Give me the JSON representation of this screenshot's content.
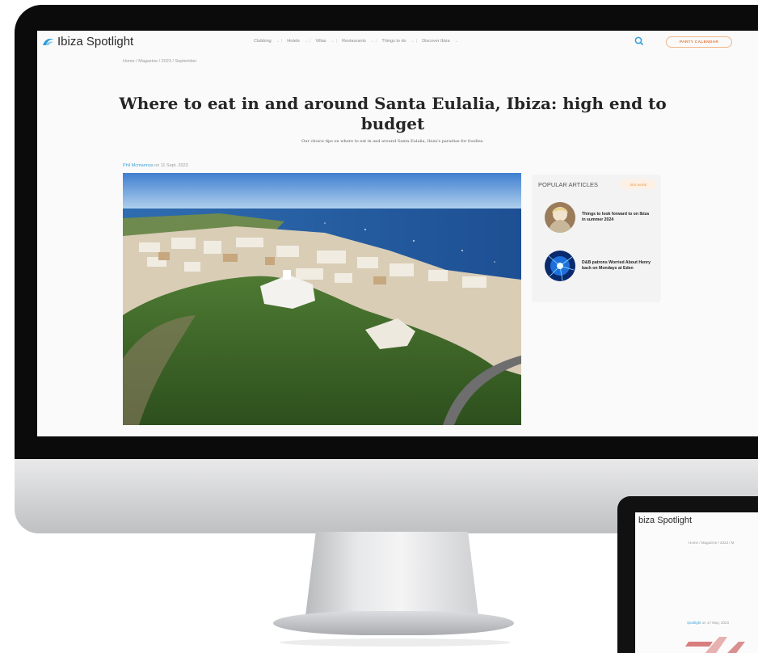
{
  "site": {
    "name": "Ibiza Spotlight",
    "nav": [
      "Clubbing",
      "Hotels",
      "Villas",
      "Restaurants",
      "Things to do",
      "Discover Ibiza"
    ],
    "cta_label": "PARTY CALENDAR",
    "accent": "#e87a3a",
    "link_color": "#3aa3d9"
  },
  "article": {
    "breadcrumb": "Home / Magazine / 2023 / September",
    "title": "Where to eat in and around Santa Eulalia, Ibiza: high end to budget",
    "subtitle": "Our choice tips on where to eat in and around Santa Eulalia, Ibiza's paradise for foodies.",
    "author": "Phil Mcmannus",
    "date_text": "on 11 Sept. 2023"
  },
  "sidebar": {
    "heading": "POPULAR ARTICLES",
    "more_label": "SEE MORE",
    "items": [
      {
        "title": "Things to look forward to on Ibiza in summer 2024"
      },
      {
        "title": "D&B patrons Worried About Henry back on Mondays at Eden"
      }
    ]
  },
  "tablet": {
    "site_name": "biza Spotlight",
    "breadcrumb": "Home / Magazine / 2023 / M",
    "author": "Spotlight",
    "date_text": "on 17 May, 2023"
  }
}
